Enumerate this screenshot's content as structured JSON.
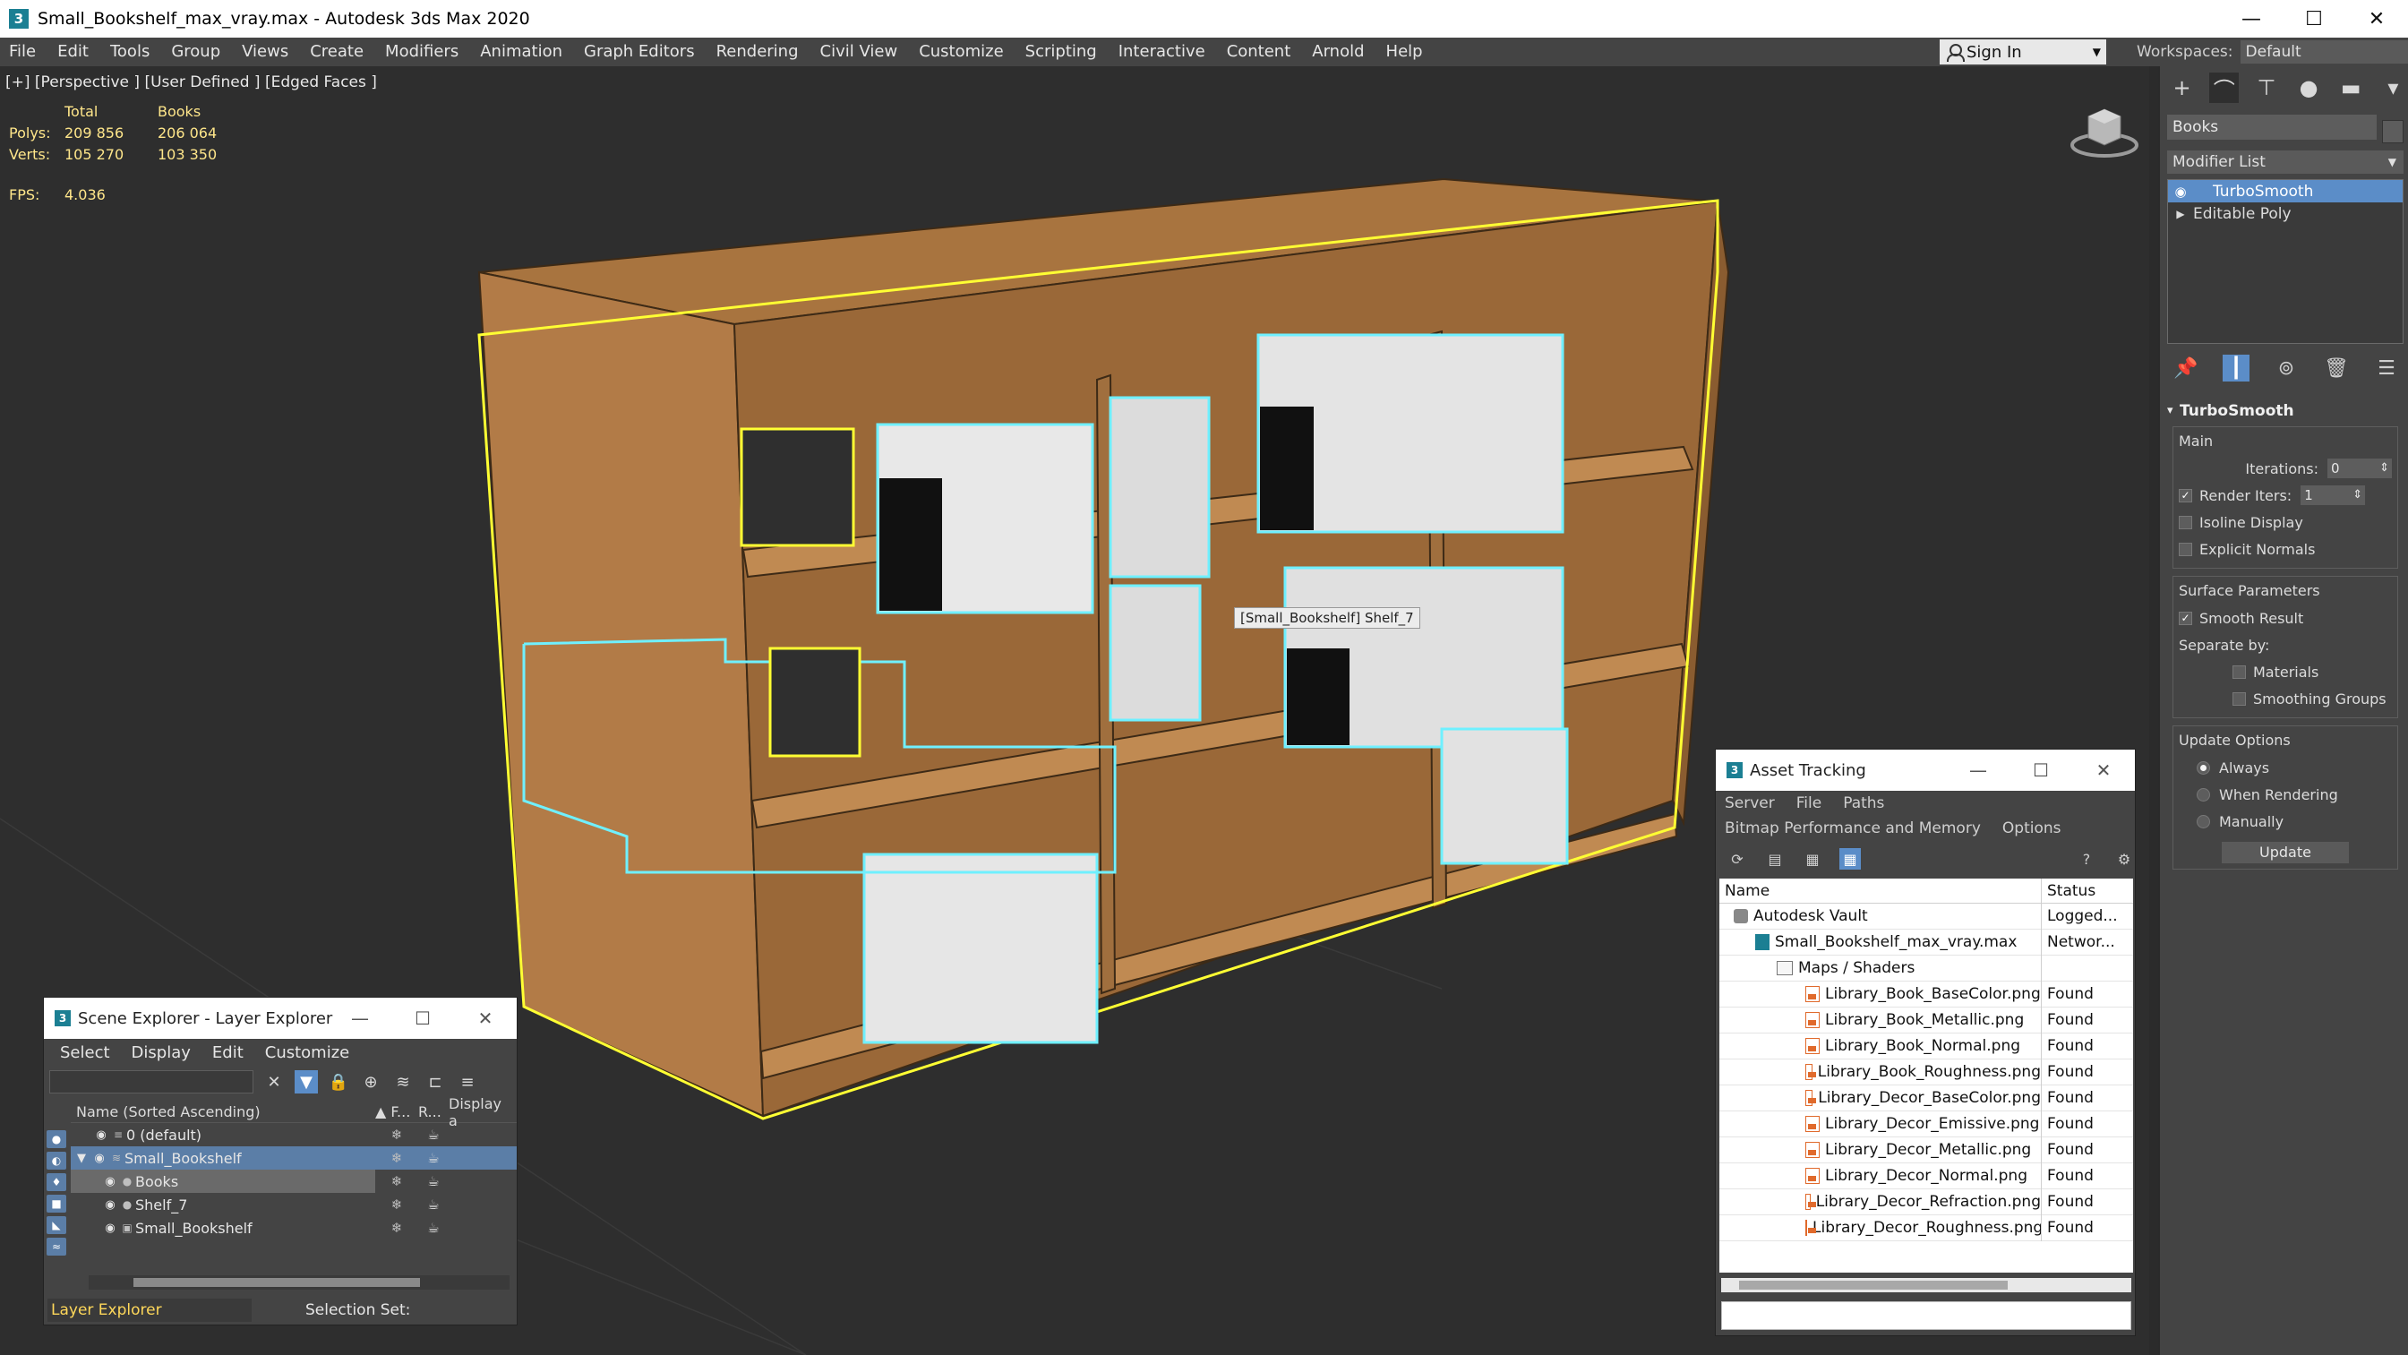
{
  "window": {
    "title": "Small_Bookshelf_max_vray.max - Autodesk 3ds Max 2020",
    "app_icon": "3",
    "minimize": "—",
    "maximize": "☐",
    "close": "✕"
  },
  "menubar": {
    "items": [
      "File",
      "Edit",
      "Tools",
      "Group",
      "Views",
      "Create",
      "Modifiers",
      "Animation",
      "Graph Editors",
      "Rendering",
      "Civil View",
      "Customize",
      "Scripting",
      "Interactive",
      "Content",
      "Arnold",
      "Help"
    ],
    "signin": "Sign In",
    "workspaces_label": "Workspaces:",
    "workspace_value": "Default"
  },
  "viewport": {
    "label": "[+] [Perspective ] [User Defined ] [Edged Faces ]",
    "stats": {
      "headers": [
        "",
        "Total",
        "Books"
      ],
      "rows": [
        [
          "Polys:",
          "209 856",
          "206 064"
        ],
        [
          "Verts:",
          "105 270",
          "103 350"
        ]
      ],
      "fps_label": "FPS:",
      "fps_value": "4.036"
    },
    "tooltip": "[Small_Bookshelf] Shelf_7",
    "colors": {
      "background": "#2e2e2e",
      "wood": "#b07a45",
      "selection_yellow": "#ffff33",
      "highlight_cyan": "#6ff0ff"
    }
  },
  "command_panel": {
    "object_name": "Books",
    "modifier_list_label": "Modifier List",
    "stack": [
      {
        "name": "TurboSmooth",
        "selected": true,
        "icon": "eye-icon"
      },
      {
        "name": "Editable Poly",
        "selected": false,
        "icon": "expand-triangle-icon"
      }
    ],
    "rollout": {
      "title": "TurboSmooth",
      "main_label": "Main",
      "iterations_label": "Iterations:",
      "iterations_value": "0",
      "render_iters_label": "Render Iters:",
      "render_iters_value": "1",
      "isoline_display": "Isoline Display",
      "explicit_normals": "Explicit Normals",
      "surface_params_label": "Surface Parameters",
      "smooth_result": "Smooth Result",
      "separate_by": "Separate by:",
      "materials": "Materials",
      "smoothing_groups": "Smoothing Groups",
      "update_options_label": "Update Options",
      "always": "Always",
      "when_rendering": "When Rendering",
      "manually": "Manually",
      "update_button": "Update"
    }
  },
  "scene_explorer": {
    "title": "Scene Explorer - Layer Explorer",
    "menus": [
      "Select",
      "Display",
      "Edit",
      "Customize"
    ],
    "columns": {
      "name": "Name (Sorted Ascending)",
      "frozen": "▲ F...",
      "render": "R...",
      "display": "Display a"
    },
    "rows": [
      {
        "name": "0 (default)",
        "indent": 0
      },
      {
        "name": "Small_Bookshelf",
        "indent": 0
      },
      {
        "name": "Books",
        "indent": 1
      },
      {
        "name": "Shelf_7",
        "indent": 1
      },
      {
        "name": "Small_Bookshelf",
        "indent": 1
      }
    ],
    "status_layer": "Layer Explorer",
    "selection_set_label": "Selection Set:"
  },
  "asset_tracking": {
    "title": "Asset Tracking",
    "menus_line1": [
      "Server",
      "File",
      "Paths"
    ],
    "menus_line2": [
      "Bitmap Performance and Memory",
      "Options"
    ],
    "columns": {
      "name": "Name",
      "status": "Status"
    },
    "rows": [
      {
        "name": "Autodesk Vault",
        "status": "Logged...",
        "icon": "vault-icon",
        "indent": 1
      },
      {
        "name": "Small_Bookshelf_max_vray.max",
        "status": "Networ...",
        "icon": "max-file-icon",
        "indent": 2
      },
      {
        "name": "Maps / Shaders",
        "status": "",
        "icon": "folder-icon",
        "indent": 3
      },
      {
        "name": "Library_Book_BaseColor.png",
        "status": "Found",
        "icon": "bitmap-icon",
        "indent": 4
      },
      {
        "name": "Library_Book_Metallic.png",
        "status": "Found",
        "icon": "bitmap-icon",
        "indent": 4
      },
      {
        "name": "Library_Book_Normal.png",
        "status": "Found",
        "icon": "bitmap-icon",
        "indent": 4
      },
      {
        "name": "Library_Book_Roughness.png",
        "status": "Found",
        "icon": "bitmap-icon",
        "indent": 4
      },
      {
        "name": "Library_Decor_BaseColor.png",
        "status": "Found",
        "icon": "bitmap-icon",
        "indent": 4
      },
      {
        "name": "Library_Decor_Emissive.png",
        "status": "Found",
        "icon": "bitmap-icon",
        "indent": 4
      },
      {
        "name": "Library_Decor_Metallic.png",
        "status": "Found",
        "icon": "bitmap-icon",
        "indent": 4
      },
      {
        "name": "Library_Decor_Normal.png",
        "status": "Found",
        "icon": "bitmap-icon",
        "indent": 4
      },
      {
        "name": "Library_Decor_Refraction.png",
        "status": "Found",
        "icon": "bitmap-icon",
        "indent": 4
      },
      {
        "name": "Library_Decor_Roughness.png",
        "status": "Found",
        "icon": "bitmap-icon",
        "indent": 4
      }
    ]
  }
}
